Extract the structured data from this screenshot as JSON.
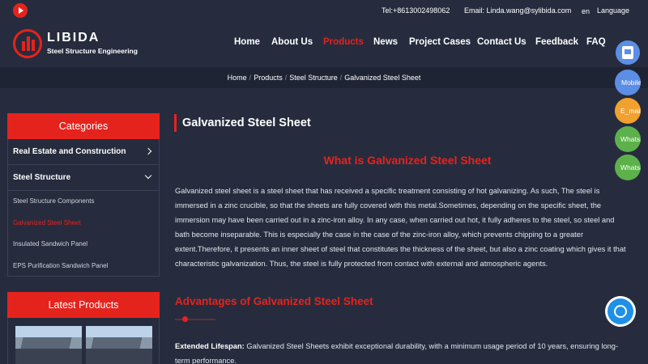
{
  "topbar": {
    "phone": "Tel:+8613002498062",
    "email": "Email: Linda.wang@sylibida.com",
    "lang_code": "en",
    "language": "Language"
  },
  "brand": {
    "name": "LIBIDA",
    "tagline": "Steel Structure Engineering",
    "accent": "#e5231d"
  },
  "nav": [
    "Home",
    "About Us",
    "Products",
    "News",
    "Project Cases",
    "Contact Us",
    "Feedback",
    "FAQ"
  ],
  "breadcrumb": [
    "Home",
    "Products",
    "Steel Structure",
    "Galvanized Steel Sheet"
  ],
  "sidebar": {
    "categories_title": "Categories",
    "categories": [
      "Real Estate and Construction",
      "Steel Structure"
    ],
    "subitems": [
      "Steel Structure Components",
      "Galvanized Steel Sheet",
      "Insulated Sandwich Panel",
      "EPS Purification Sandwich Panel"
    ],
    "latest_title": "Latest Products"
  },
  "main": {
    "title": "Galvanized Steel Sheet",
    "what_heading": "What is Galvanized Steel Sheet",
    "what_text": "Galvanized steel sheet is a steel sheet that has received a specific treatment consisting of hot galvanizing. As such, The steel is immersed in a zinc crucible, so that the sheets are fully covered with this metal.Sometimes, depending on the specific sheet, the immersion may have been carried out in a zinc-iron alloy. In any case, when carried out hot, it fully adheres to the steel, so steel and bath become inseparable. This is especially the case in the case of the zinc-iron alloy, which prevents chipping to a greater extent.Therefore, it presents an inner sheet of steel that constitutes the thickness of the sheet, but also a zinc coating which gives it that characteristic galvanization. Thus, the steel is fully protected from contact with external and atmospheric agents.",
    "adv_heading": "Advantages of Galvanized Steel Sheet",
    "adv_label": "Extended Lifespan:",
    "adv_text": " Galvanized Steel Sheets exhibit exceptional durability, with a minimum usage period of 10 years, ensuring long-term performance."
  },
  "floating": [
    "Mobile",
    "E_mail",
    "Whatsapp",
    "Whatsapp"
  ]
}
